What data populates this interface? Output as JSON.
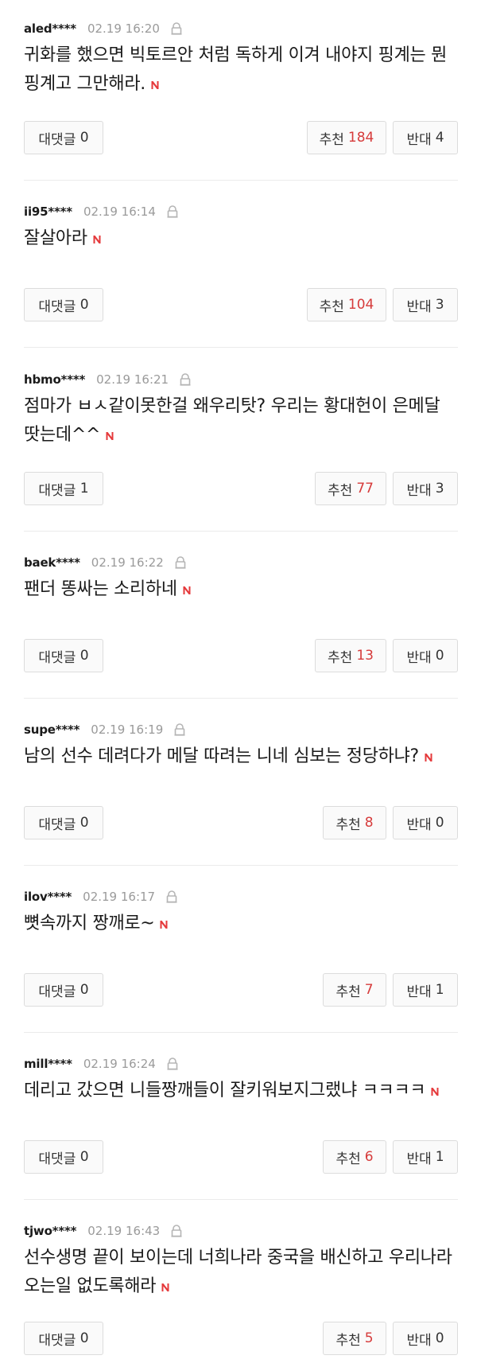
{
  "labels": {
    "reply": "대댓글",
    "agree": "추천",
    "disagree": "반대"
  },
  "comments": [
    {
      "user": "aled****",
      "time": "02.19 16:20",
      "text": "귀화를 했으면 빅토르안 처럼 독하게 이겨 내야지 핑계는 뭔 핑계고 그만해라.",
      "replies": "0",
      "agree": "184",
      "disagree": "4"
    },
    {
      "user": "ii95****",
      "time": "02.19 16:14",
      "text": "잘살아라",
      "replies": "0",
      "agree": "104",
      "disagree": "3"
    },
    {
      "user": "hbmo****",
      "time": "02.19 16:21",
      "text": "점마가 ㅂㅅ같이못한걸 왜우리탓? 우리는 황대헌이 은메달 땃는데^^",
      "replies": "1",
      "agree": "77",
      "disagree": "3"
    },
    {
      "user": "baek****",
      "time": "02.19 16:22",
      "text": "팬더 똥싸는 소리하네",
      "replies": "0",
      "agree": "13",
      "disagree": "0"
    },
    {
      "user": "supe****",
      "time": "02.19 16:19",
      "text": "남의 선수 데려다가 메달 따려는 니네 심보는 정당하냐?",
      "replies": "0",
      "agree": "8",
      "disagree": "0"
    },
    {
      "user": "ilov****",
      "time": "02.19 16:17",
      "text": "뼛속까지 짱깨로~",
      "replies": "0",
      "agree": "7",
      "disagree": "1"
    },
    {
      "user": "mill****",
      "time": "02.19 16:24",
      "text": "데리고 갔으면 니들짱깨들이 잘키워보지그랬냐 ㅋㅋㅋㅋ",
      "replies": "0",
      "agree": "6",
      "disagree": "1"
    },
    {
      "user": "tjwo****",
      "time": "02.19 16:43",
      "text": "선수생명 끝이 보이는데 너희나라 중국을 배신하고 우리나라 오는일 없도록해라",
      "replies": "0",
      "agree": "5",
      "disagree": "0"
    }
  ]
}
